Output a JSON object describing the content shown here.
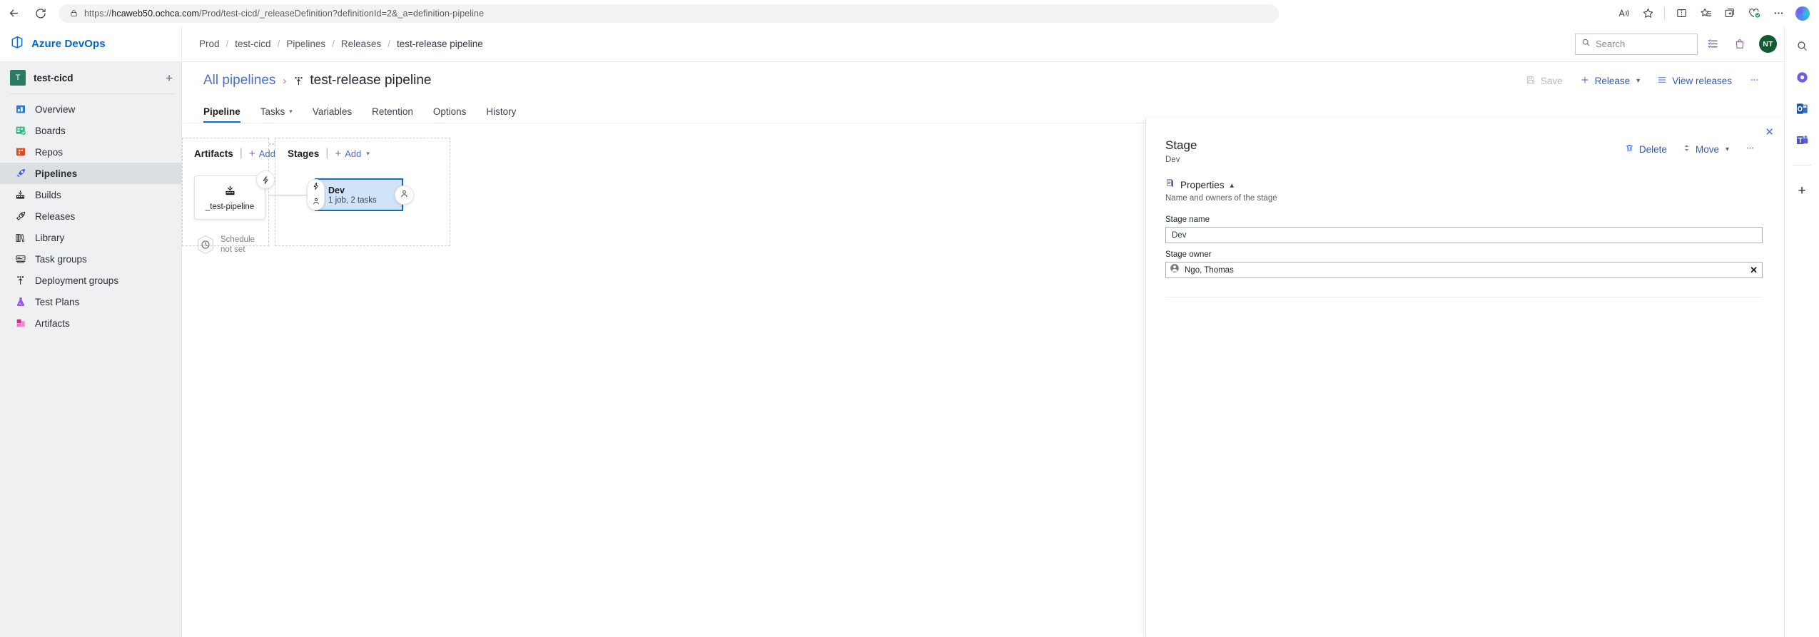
{
  "browser": {
    "back_icon": "back-arrow-icon",
    "reload_icon": "reload-icon",
    "lock_icon": "lock-icon",
    "url_prefix": "https://",
    "url_host": "hcaweb50.ochca.com",
    "url_path": "/Prod/test-cicd/_releaseDefinition?definitionId=2&_a=definition-pipeline",
    "toolbar_icons": [
      {
        "name": "read-aloud-icon",
        "label": "Read aloud"
      },
      {
        "name": "favorite-star-icon",
        "label": "Add to favorites"
      },
      {
        "name": "split-screen-icon",
        "label": "Split screen"
      },
      {
        "name": "favorites-list-icon",
        "label": "Favorites"
      },
      {
        "name": "collections-icon",
        "label": "Collections"
      },
      {
        "name": "browser-essentials-icon",
        "label": "Browser essentials"
      },
      {
        "name": "settings-more-icon",
        "label": "Settings and more"
      },
      {
        "name": "copilot-icon",
        "label": "Copilot"
      }
    ]
  },
  "edge_rail": {
    "items": [
      {
        "name": "rail-search-icon",
        "label": "Search"
      },
      {
        "name": "rail-copilot-icon",
        "label": "Copilot"
      },
      {
        "name": "rail-outlook-icon",
        "label": "Outlook"
      },
      {
        "name": "rail-teams-icon",
        "label": "Teams"
      }
    ],
    "add_label": "+"
  },
  "header": {
    "brand": "Azure DevOps",
    "logo_icon": "azure-devops-logo-icon",
    "breadcrumb": [
      "Prod",
      "test-cicd",
      "Pipelines",
      "Releases",
      "test-release pipeline"
    ],
    "breadcrumb_separator": "/",
    "search_placeholder": "Search",
    "search_icon": "search-icon",
    "marketplace_icon": "marketplace-icon",
    "shopping_bag_icon": "shopping-bag-icon",
    "avatar_initials": "NT"
  },
  "sidebar": {
    "project_initial": "T",
    "project_name": "test-cicd",
    "add_label": "+",
    "items": [
      {
        "label": "Overview",
        "icon": "overview-icon",
        "selected": false
      },
      {
        "label": "Boards",
        "icon": "boards-icon",
        "selected": false
      },
      {
        "label": "Repos",
        "icon": "repos-icon",
        "selected": false
      },
      {
        "label": "Pipelines",
        "icon": "pipelines-icon",
        "selected": true
      },
      {
        "label": "Builds",
        "icon": "builds-icon",
        "selected": false
      },
      {
        "label": "Releases",
        "icon": "releases-icon",
        "selected": false
      },
      {
        "label": "Library",
        "icon": "library-icon",
        "selected": false
      },
      {
        "label": "Task groups",
        "icon": "task-groups-icon",
        "selected": false
      },
      {
        "label": "Deployment groups",
        "icon": "deployment-groups-icon",
        "selected": false
      },
      {
        "label": "Test Plans",
        "icon": "test-plans-icon",
        "selected": false
      },
      {
        "label": "Artifacts",
        "icon": "artifacts-icon",
        "selected": false
      }
    ]
  },
  "page": {
    "all_pipelines_label": "All pipelines",
    "chevron": "›",
    "pipeline_icon": "release-pipeline-icon",
    "pipeline_name": "test-release pipeline",
    "commands": {
      "save": "Save",
      "save_icon": "save-disk-icon",
      "release": "Release",
      "release_icon": "plus-icon",
      "view_releases": "View releases",
      "view_releases_icon": "list-icon",
      "more_icon": "ellipsis-icon"
    },
    "tabs": [
      {
        "label": "Pipeline",
        "active": true,
        "has_chevron": false
      },
      {
        "label": "Tasks",
        "active": false,
        "has_chevron": true
      },
      {
        "label": "Variables",
        "active": false,
        "has_chevron": false
      },
      {
        "label": "Retention",
        "active": false,
        "has_chevron": false
      },
      {
        "label": "Options",
        "active": false,
        "has_chevron": false
      },
      {
        "label": "History",
        "active": false,
        "has_chevron": false
      }
    ]
  },
  "canvas": {
    "artifacts": {
      "title": "Artifacts",
      "separator": "|",
      "add_label": "Add",
      "card": {
        "icon": "build-artifact-icon",
        "label": "_test-pipeline",
        "trigger_badge_icon": "continuous-deployment-trigger-icon"
      },
      "schedule": {
        "icon": "clock-icon",
        "line1": "Schedule",
        "line2": "not set"
      }
    },
    "stages": {
      "title": "Stages",
      "separator": "|",
      "add_label": "Add",
      "nodes": [
        {
          "name": "Dev",
          "subtitle": "1 job, 2 tasks",
          "selected": true,
          "pre_badge_icons": [
            "pre-deployment-trigger-icon",
            "pre-deployment-approval-icon"
          ],
          "post_badge_icon": "post-deployment-approval-icon"
        }
      ]
    }
  },
  "detail_panel": {
    "close_icon": "close-icon",
    "title": "Stage",
    "subtitle": "Dev",
    "actions": {
      "delete": "Delete",
      "delete_icon": "trash-icon",
      "move": "Move",
      "move_icon": "move-updown-icon",
      "more_icon": "ellipsis-icon"
    },
    "properties": {
      "section_icon": "properties-icon",
      "section_title": "Properties",
      "collapse_chevron": "⌃",
      "description": "Name and owners of the stage",
      "stage_name_label": "Stage name",
      "stage_name_value": "Dev",
      "stage_owner_label": "Stage owner",
      "stage_owner_value": "Ngo, Thomas",
      "stage_owner_avatar_icon": "person-avatar-icon",
      "stage_owner_clear_icon": "clear-x-icon"
    }
  }
}
